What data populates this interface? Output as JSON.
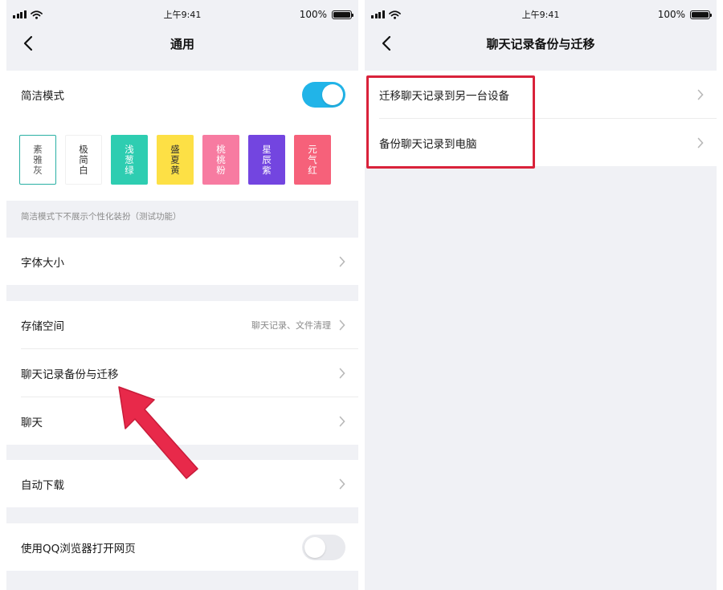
{
  "status_bar": {
    "time": "上午9:41",
    "battery": "100%"
  },
  "left_screen": {
    "title": "通用",
    "simple_mode": {
      "label": "简洁模式",
      "enabled": true
    },
    "themes": [
      {
        "name": "素雅灰",
        "chars": [
          "素",
          "雅",
          "灰"
        ],
        "bg": "#ffffff",
        "fg": "#555555",
        "selected": true
      },
      {
        "name": "极简白",
        "chars": [
          "极",
          "简",
          "白"
        ],
        "bg": "#ffffff",
        "fg": "#333333",
        "selected": false
      },
      {
        "name": "浅葱绿",
        "chars": [
          "浅",
          "葱",
          "绿"
        ],
        "bg": "#2ecdb1",
        "fg": "#ffffff",
        "selected": false
      },
      {
        "name": "盛夏黄",
        "chars": [
          "盛",
          "夏",
          "黄"
        ],
        "bg": "#fde045",
        "fg": "#333333",
        "selected": false
      },
      {
        "name": "桃桃粉",
        "chars": [
          "桃",
          "桃",
          "粉"
        ],
        "bg": "#f77ba1",
        "fg": "#ffffff",
        "selected": false
      },
      {
        "name": "星辰紫",
        "chars": [
          "星",
          "辰",
          "紫"
        ],
        "bg": "#7345e0",
        "fg": "#ffffff",
        "selected": false
      },
      {
        "name": "元气红",
        "chars": [
          "元",
          "气",
          "红"
        ],
        "bg": "#f6617a",
        "fg": "#ffffff",
        "selected": false
      }
    ],
    "simple_mode_note": "简洁模式下不展示个性化装扮（测试功能）",
    "font_size_label": "字体大小",
    "storage": {
      "label": "存储空间",
      "detail": "聊天记录、文件清理"
    },
    "chat_backup_label": "聊天记录备份与迁移",
    "chat_label": "聊天",
    "auto_download_label": "自动下载",
    "qq_browser": {
      "label": "使用QQ浏览器打开网页",
      "enabled": false
    }
  },
  "right_screen": {
    "title": "聊天记录备份与迁移",
    "migrate_label": "迁移聊天记录到另一台设备",
    "backup_pc_label": "备份聊天记录到电脑"
  },
  "colors": {
    "accent": "#21b4e8",
    "highlight": "#d9223a",
    "arrow": "#e8294a",
    "page_bg": "#f0f1f5"
  }
}
